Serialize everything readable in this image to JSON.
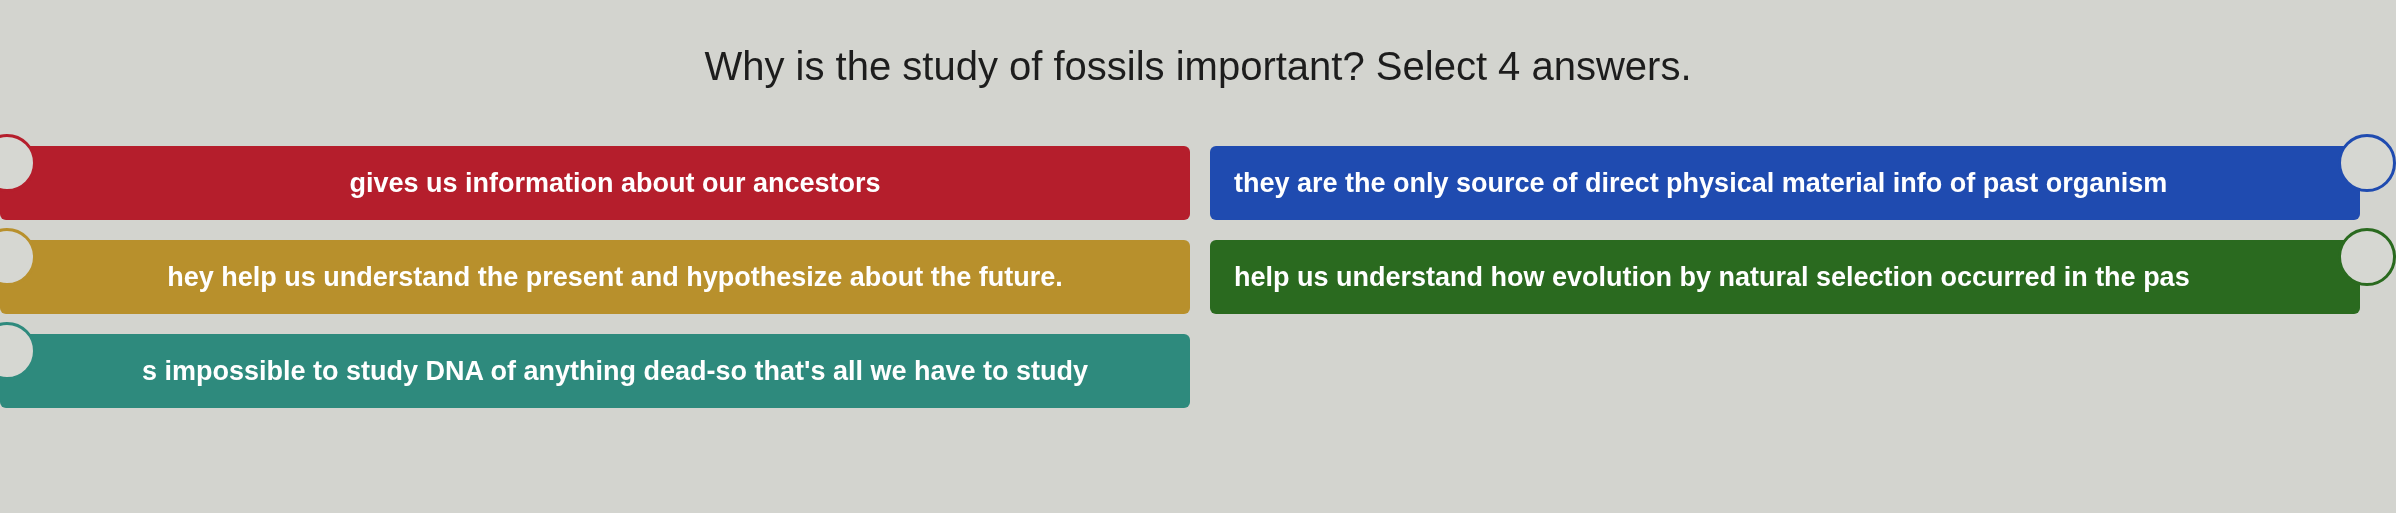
{
  "question": "Why is the study of fossils important? Select 4 answers.",
  "options": [
    {
      "text": "gives us information about our ancestors",
      "color": "#b51e2c",
      "selected": false
    },
    {
      "text": "they are the only source of direct physical material info of past organism",
      "color": "#1f4bb0",
      "selected": false
    },
    {
      "text": "hey help us understand the present and hypothesize about the future.",
      "color": "#b8902c",
      "selected": false
    },
    {
      "text": "help us understand how evolution by natural selection occurred in the pas",
      "color": "#2a6a1f",
      "selected": false
    },
    {
      "text": "s impossible to study DNA of anything dead-so that's all we have to study",
      "color": "#2e8a7d",
      "selected": false
    }
  ]
}
